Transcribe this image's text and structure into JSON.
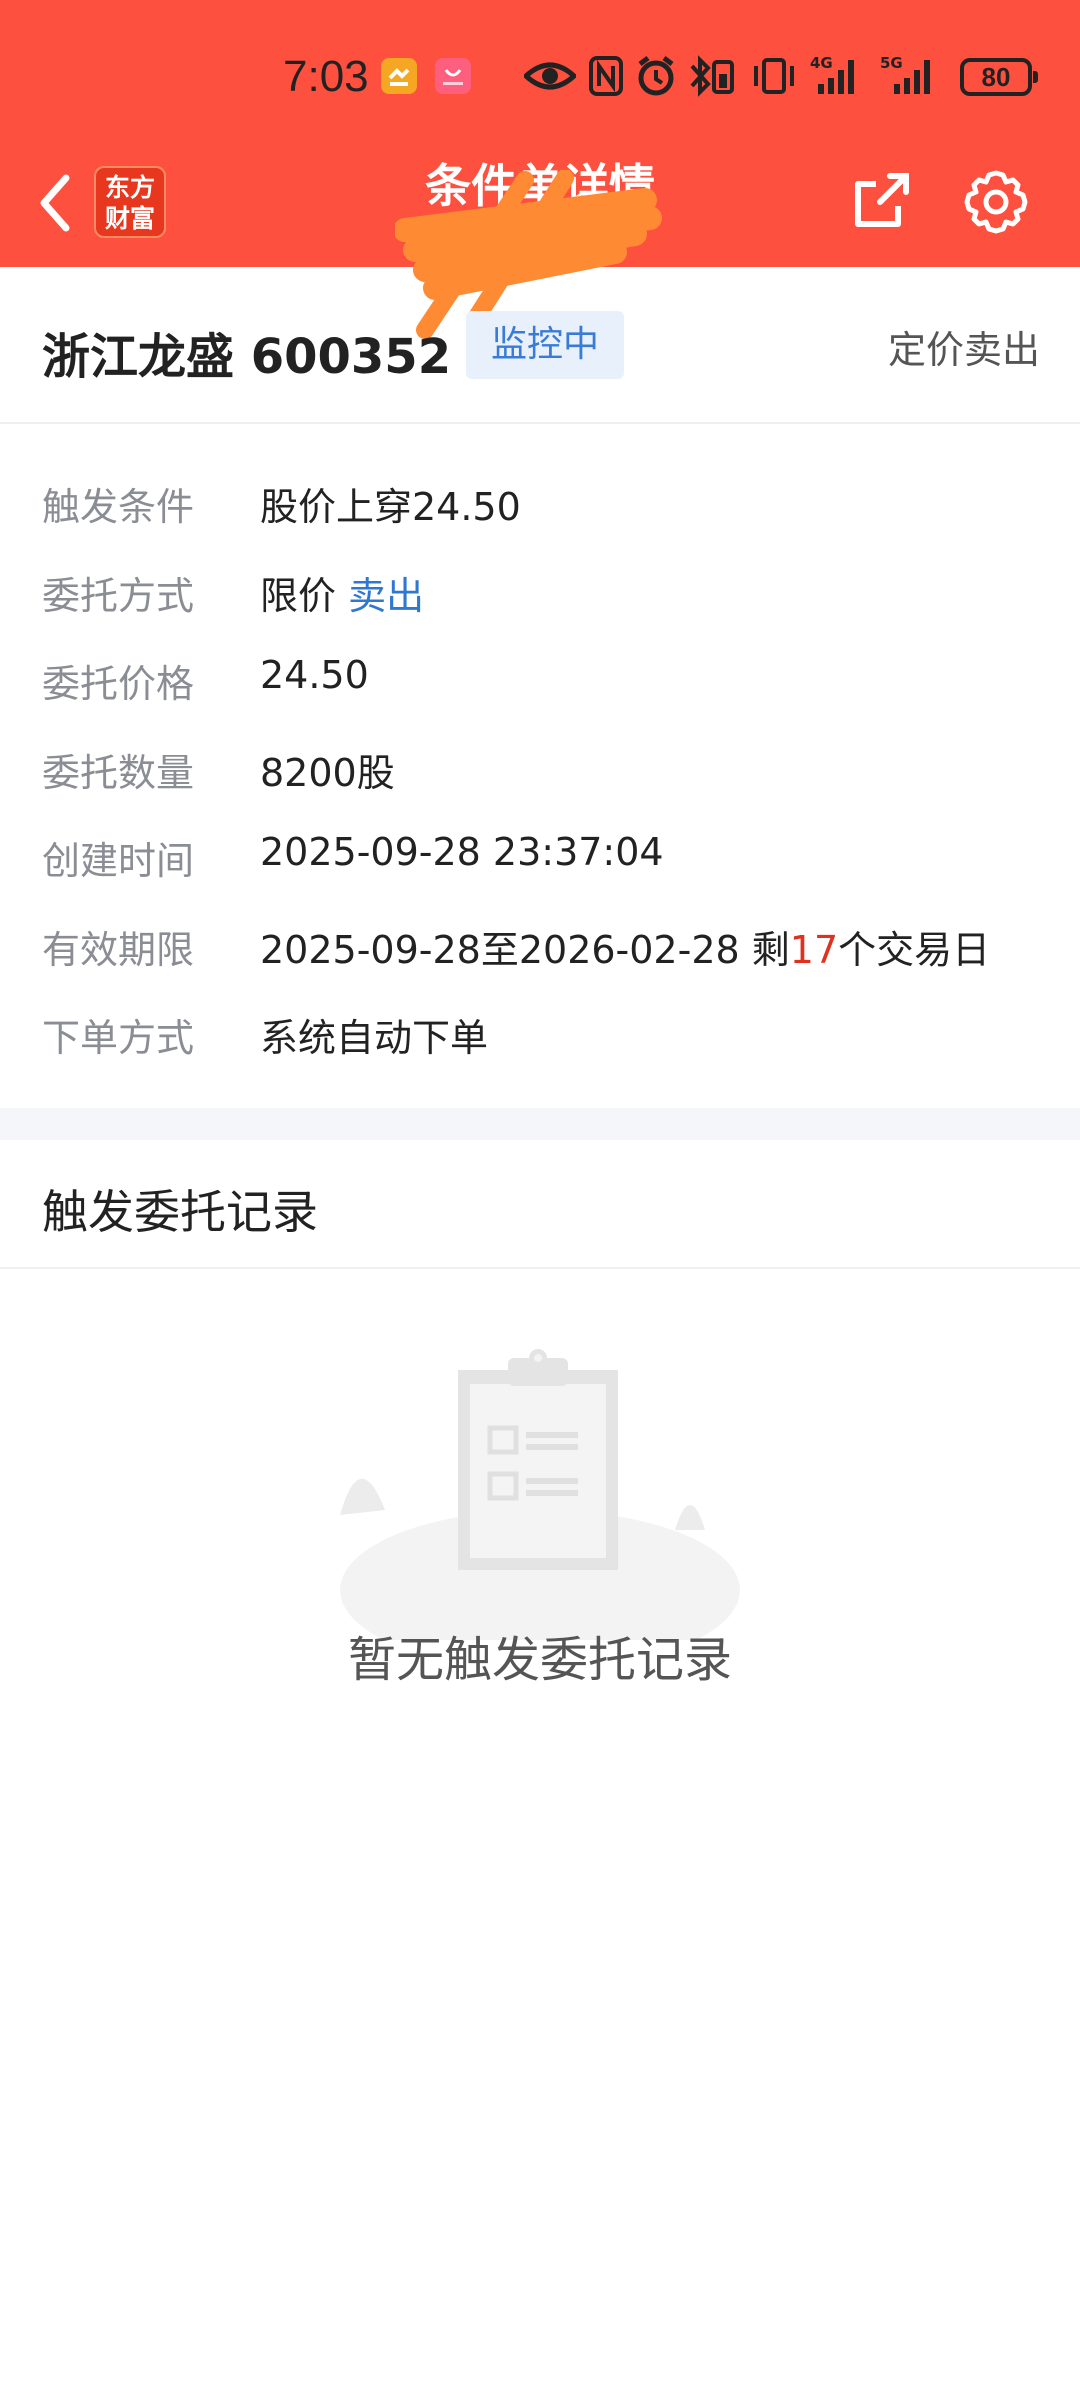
{
  "status_bar": {
    "time": "7:03",
    "battery": "80",
    "icons": [
      "app-notification-icon",
      "huawei-notification-icon",
      "eye-icon",
      "nfc-icon",
      "alarm-icon",
      "bluetooth-icon",
      "vibrate-icon",
      "signal-4g-icon",
      "signal-5g-icon"
    ]
  },
  "nav": {
    "title": "条件单详情",
    "logo_line1": "东方",
    "logo_line2": "财富"
  },
  "stock": {
    "name_code": "浙江龙盛 600352",
    "status": "监控中",
    "order_type": "定价卖出"
  },
  "details": {
    "trigger": {
      "label": "触发条件",
      "value": "股价上穿24.50"
    },
    "method": {
      "label": "委托方式",
      "value_prefix": "限价 ",
      "value_action": "卖出"
    },
    "price": {
      "label": "委托价格",
      "value": "24.50"
    },
    "quantity": {
      "label": "委托数量",
      "value": "8200股"
    },
    "created": {
      "label": "创建时间",
      "value": "2025-09-28 23:37:04"
    },
    "validity": {
      "label": "有效期限",
      "value_prefix": "2025-09-28至2026-02-28 剩",
      "days": "17",
      "value_suffix": "个交易日"
    },
    "placement": {
      "label": "下单方式",
      "value": "系统自动下单"
    }
  },
  "records": {
    "title": "触发委托记录",
    "empty_text": "暂无触发委托记录"
  },
  "colors": {
    "header": "#fd503e",
    "accent_blue": "#2f78d2",
    "accent_red": "#e0301e"
  }
}
